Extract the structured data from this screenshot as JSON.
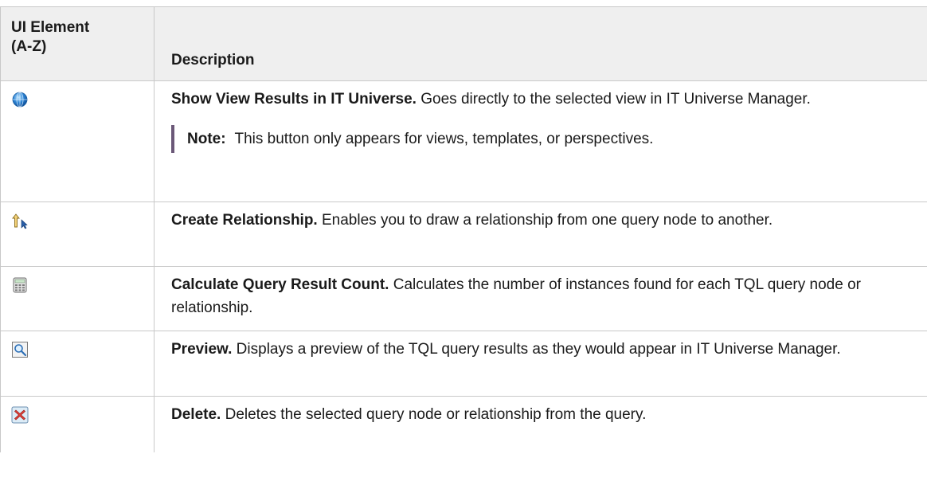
{
  "table": {
    "headers": {
      "element_line1": "UI Element",
      "element_line2": "(A-Z)",
      "description": "Description"
    },
    "rows": [
      {
        "icon": "globe-icon",
        "title": "Show View Results in IT Universe.",
        "text": " Goes directly to the selected view in IT Universe Manager.",
        "note_label": "Note:",
        "note_text": "This button only appears for views, templates, or perspectives."
      },
      {
        "icon": "create-relationship-icon",
        "title": "Create Relationship.",
        "text": " Enables you to draw a relationship from one query node to another."
      },
      {
        "icon": "calculator-icon",
        "title": "Calculate Query Result Count.",
        "text": " Calculates the number of instances found for each TQL query node or relationship."
      },
      {
        "icon": "preview-magnifier-icon",
        "title": "Preview.",
        "text": " Displays a preview of the TQL query results as they would appear in IT Universe Manager."
      },
      {
        "icon": "delete-x-icon",
        "title": "Delete.",
        "text": " Deletes the selected query node or relationship from the query."
      }
    ]
  },
  "colors": {
    "header_bg": "#efefef",
    "border": "#c8c8c8",
    "note_bar": "#6b5878"
  }
}
